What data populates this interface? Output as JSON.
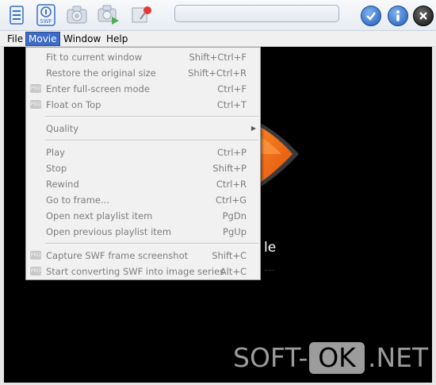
{
  "menubar": {
    "items": [
      {
        "label": "File"
      },
      {
        "label": "Movie"
      },
      {
        "label": "Window"
      },
      {
        "label": "Help"
      }
    ]
  },
  "toolbar": {
    "swf_label": "SWF",
    "search_value": ""
  },
  "movie_menu": {
    "items": [
      {
        "label": "Fit to current window",
        "shortcut": "Shift+Ctrl+F"
      },
      {
        "label": "Restore the original size",
        "shortcut": "Shift+Ctrl+R"
      },
      {
        "label": "Enter full-screen mode",
        "shortcut": "Ctrl+F",
        "pro": true
      },
      {
        "label": "Float on Top",
        "shortcut": "Ctrl+T",
        "pro": true
      },
      {
        "label": "Quality",
        "shortcut": "",
        "submenu": true
      },
      {
        "label": "Play",
        "shortcut": "Ctrl+P"
      },
      {
        "label": "Stop",
        "shortcut": "Shift+P"
      },
      {
        "label": "Rewind",
        "shortcut": "Ctrl+R"
      },
      {
        "label": "Go to frame...",
        "shortcut": "Ctrl+G"
      },
      {
        "label": "Open next playlist item",
        "shortcut": "PgDn"
      },
      {
        "label": "Open  previous playlist item",
        "shortcut": "PgUp"
      },
      {
        "label": "Capture SWF frame screenshot",
        "shortcut": "Shift+C",
        "pro": true
      },
      {
        "label": "Start converting SWF into image series",
        "shortcut": "Alt+C",
        "pro": true
      }
    ],
    "pro_badge": "PRO"
  },
  "background": {
    "text_fragment": "le",
    "dots": "....."
  },
  "watermark": {
    "left": "SOFT-",
    "boxed": "OK",
    "right": ".NET"
  },
  "colors": {
    "menu_highlight": "#3d6bc7",
    "orange_logo": "#f26a0f",
    "disabled_text": "#7d7d7d"
  }
}
